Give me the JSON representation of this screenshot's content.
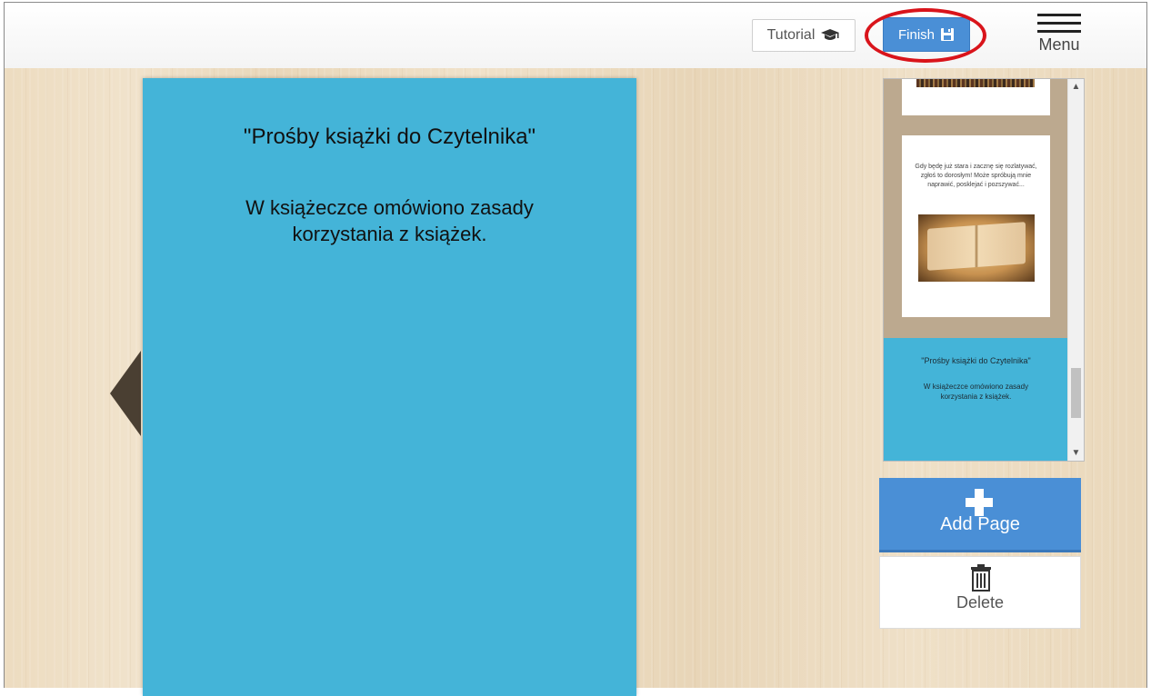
{
  "toolbar": {
    "tutorial_label": "Tutorial",
    "tutorial_icon": "graduation-cap-icon",
    "finish_label": "Finish",
    "finish_icon": "save-icon",
    "menu_label": "Menu",
    "menu_icon": "hamburger-icon",
    "highlight_color": "#d9141b"
  },
  "editor": {
    "page_color": "#44b4d8",
    "page_title": "\"Prośby książki do Czytelnika\"",
    "page_body": "W książeczce omówiono zasady korzystania z książek."
  },
  "thumbnails": {
    "items": [
      {
        "type": "image-page"
      },
      {
        "type": "text-image-page",
        "text": "Gdy będę już stara i zacznę się rozlatywać, zgłoś to dorosłym! Może spróbują mnie naprawić, posklejać i pozszywać..."
      },
      {
        "type": "text-page",
        "title": "\"Prośby książki do Czytelnika\"",
        "body": "W książeczce omówiono zasady korzystania z książek."
      }
    ]
  },
  "actions": {
    "add_label": "Add Page",
    "add_icon": "plus-icon",
    "delete_label": "Delete",
    "delete_icon": "trash-icon",
    "accent_color": "#4a8fd6"
  }
}
